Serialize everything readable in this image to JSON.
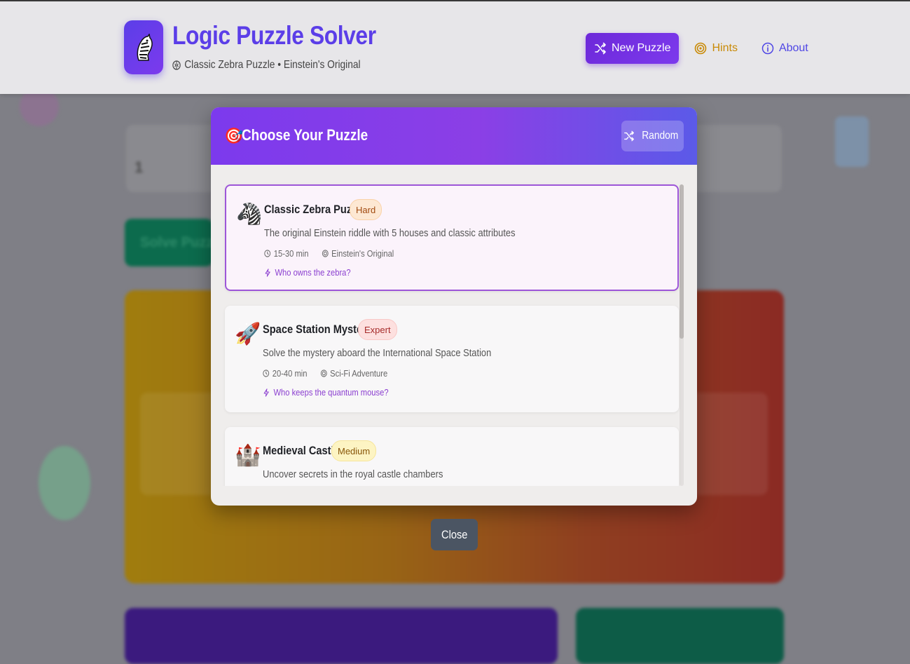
{
  "header": {
    "title": "Logic Puzzle Solver",
    "subtitle": "Classic Zebra Puzzle • Einstein's Original",
    "nav": {
      "new_puzzle": "New Puzzle",
      "hints": "Hints",
      "about": "About"
    }
  },
  "background": {
    "stat_value": "1",
    "solve_label": "Solve Puzzle"
  },
  "modal": {
    "title_emoji": "🎯",
    "title": "Choose Your Puzzle",
    "random_label": "Random",
    "close_label": "Close",
    "puzzles": [
      {
        "emoji": "🦓",
        "name": "Classic Zebra Puzzle",
        "difficulty": "Hard",
        "description": "The original Einstein riddle with 5 houses and classic attributes",
        "time": "15-30 min",
        "category": "Einstein's Original",
        "question": "Who owns the zebra?",
        "selected": true
      },
      {
        "emoji": "🚀",
        "name": "Space Station Mystery",
        "difficulty": "Expert",
        "description": "Solve the mystery aboard the International Space Station",
        "time": "20-40 min",
        "category": "Sci-Fi Adventure",
        "question": "Who keeps the quantum mouse?",
        "selected": false
      },
      {
        "emoji": "🏰",
        "name": "Medieval Castle",
        "difficulty": "Medium",
        "description": "Uncover secrets in the royal castle chambers",
        "selected": false
      }
    ]
  },
  "colors": {
    "primary": "#5b3ee8",
    "accent_purple": "#7c3aed",
    "hints": "#c98a06",
    "close_button": "#4b5563"
  },
  "icons": {
    "logo": "zebra-icon",
    "new_puzzle": "shuffle-icon",
    "hints": "target-icon",
    "about": "info-icon"
  }
}
